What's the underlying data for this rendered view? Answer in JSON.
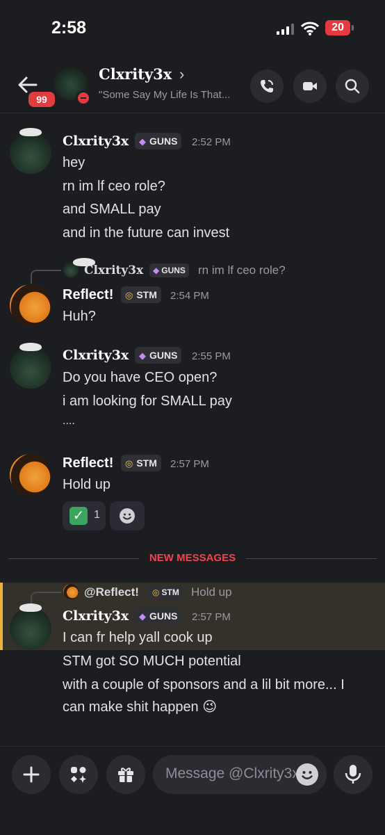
{
  "status_bar": {
    "time": "2:58",
    "battery": "20"
  },
  "header": {
    "unread_badge": "99",
    "name": "Clxrity3x",
    "chevron": "›",
    "status": "\"Some Say My Life Is That..."
  },
  "messages": [
    {
      "author": "Clxrity3x",
      "tag": "GUNS",
      "tag_icon": "gem-icon",
      "time": "2:52 PM",
      "lines": [
        "hey",
        "rn im lf ceo role?",
        "and SMALL pay",
        "and in the future can invest"
      ]
    },
    {
      "reply": {
        "author": "Clxrity3x",
        "tag": "GUNS",
        "text": "rn im lf ceo role?"
      },
      "author": "Reflect!",
      "tag": "STM",
      "tag_icon": "coin-icon",
      "time": "2:54 PM",
      "lines": [
        "Huh?"
      ]
    },
    {
      "author": "Clxrity3x",
      "tag": "GUNS",
      "tag_icon": "gem-icon",
      "time": "2:55 PM",
      "lines": [
        "Do you have CEO open?",
        "i am looking for SMALL pay",
        "...."
      ]
    },
    {
      "author": "Reflect!",
      "tag": "STM",
      "tag_icon": "coin-icon",
      "time": "2:57 PM",
      "lines": [
        "Hold up"
      ],
      "reaction": {
        "emoji": "✓",
        "count": "1"
      }
    },
    {
      "reply": {
        "author": "@Reflect!",
        "tag": "STM",
        "text": "Hold up"
      },
      "author": "Clxrity3x",
      "tag": "GUNS",
      "tag_icon": "gem-icon",
      "time": "2:57 PM",
      "lines": [
        "I can fr help yall cook up",
        "STM got SO MUCH potential",
        "with a couple of sponsors and a lil bit more... I",
        "can make shit happen 😉"
      ]
    }
  ],
  "divider_label": "NEW MESSAGES",
  "composer": {
    "placeholder": "Message @Clxrity3x"
  },
  "colors": {
    "accent_red": "#e23c43",
    "highlight_bar": "#e8b53a",
    "background": "#1c1d21"
  }
}
